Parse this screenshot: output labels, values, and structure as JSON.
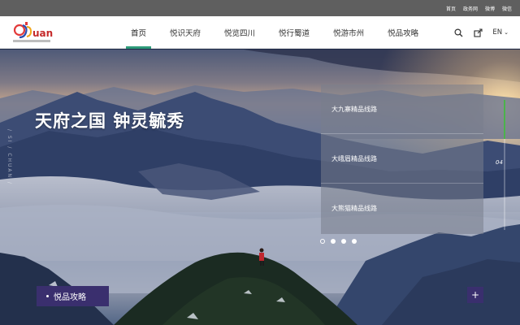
{
  "topbar": {
    "links": [
      "首页",
      "政务网",
      "微博",
      "微信"
    ]
  },
  "header": {
    "logo_text": "Sichuan",
    "nav": [
      {
        "label": "首页",
        "active": true
      },
      {
        "label": "悦识天府",
        "active": false
      },
      {
        "label": "悦览四川",
        "active": false
      },
      {
        "label": "悦行蜀道",
        "active": false
      },
      {
        "label": "悦游市州",
        "active": false
      },
      {
        "label": "悦品攻略",
        "active": false
      }
    ],
    "icons": [
      "search-icon",
      "share-icon"
    ],
    "language": "EN"
  },
  "hero": {
    "headline": "天府之国 钟灵毓秀",
    "side_text": "/ SI / CHUAN /",
    "routes": [
      "大九寨精品线路",
      "大峨眉精品线路",
      "大熊猫精品线路"
    ],
    "dots": [
      true,
      false,
      false,
      false
    ],
    "slide_number": "04",
    "progress": 0.3,
    "guide_button": "悦品攻略",
    "plus_label": "+"
  },
  "colors": {
    "accent": "#2e9b7a",
    "button": "#3a2f6e",
    "progress": "#4bb34b"
  }
}
